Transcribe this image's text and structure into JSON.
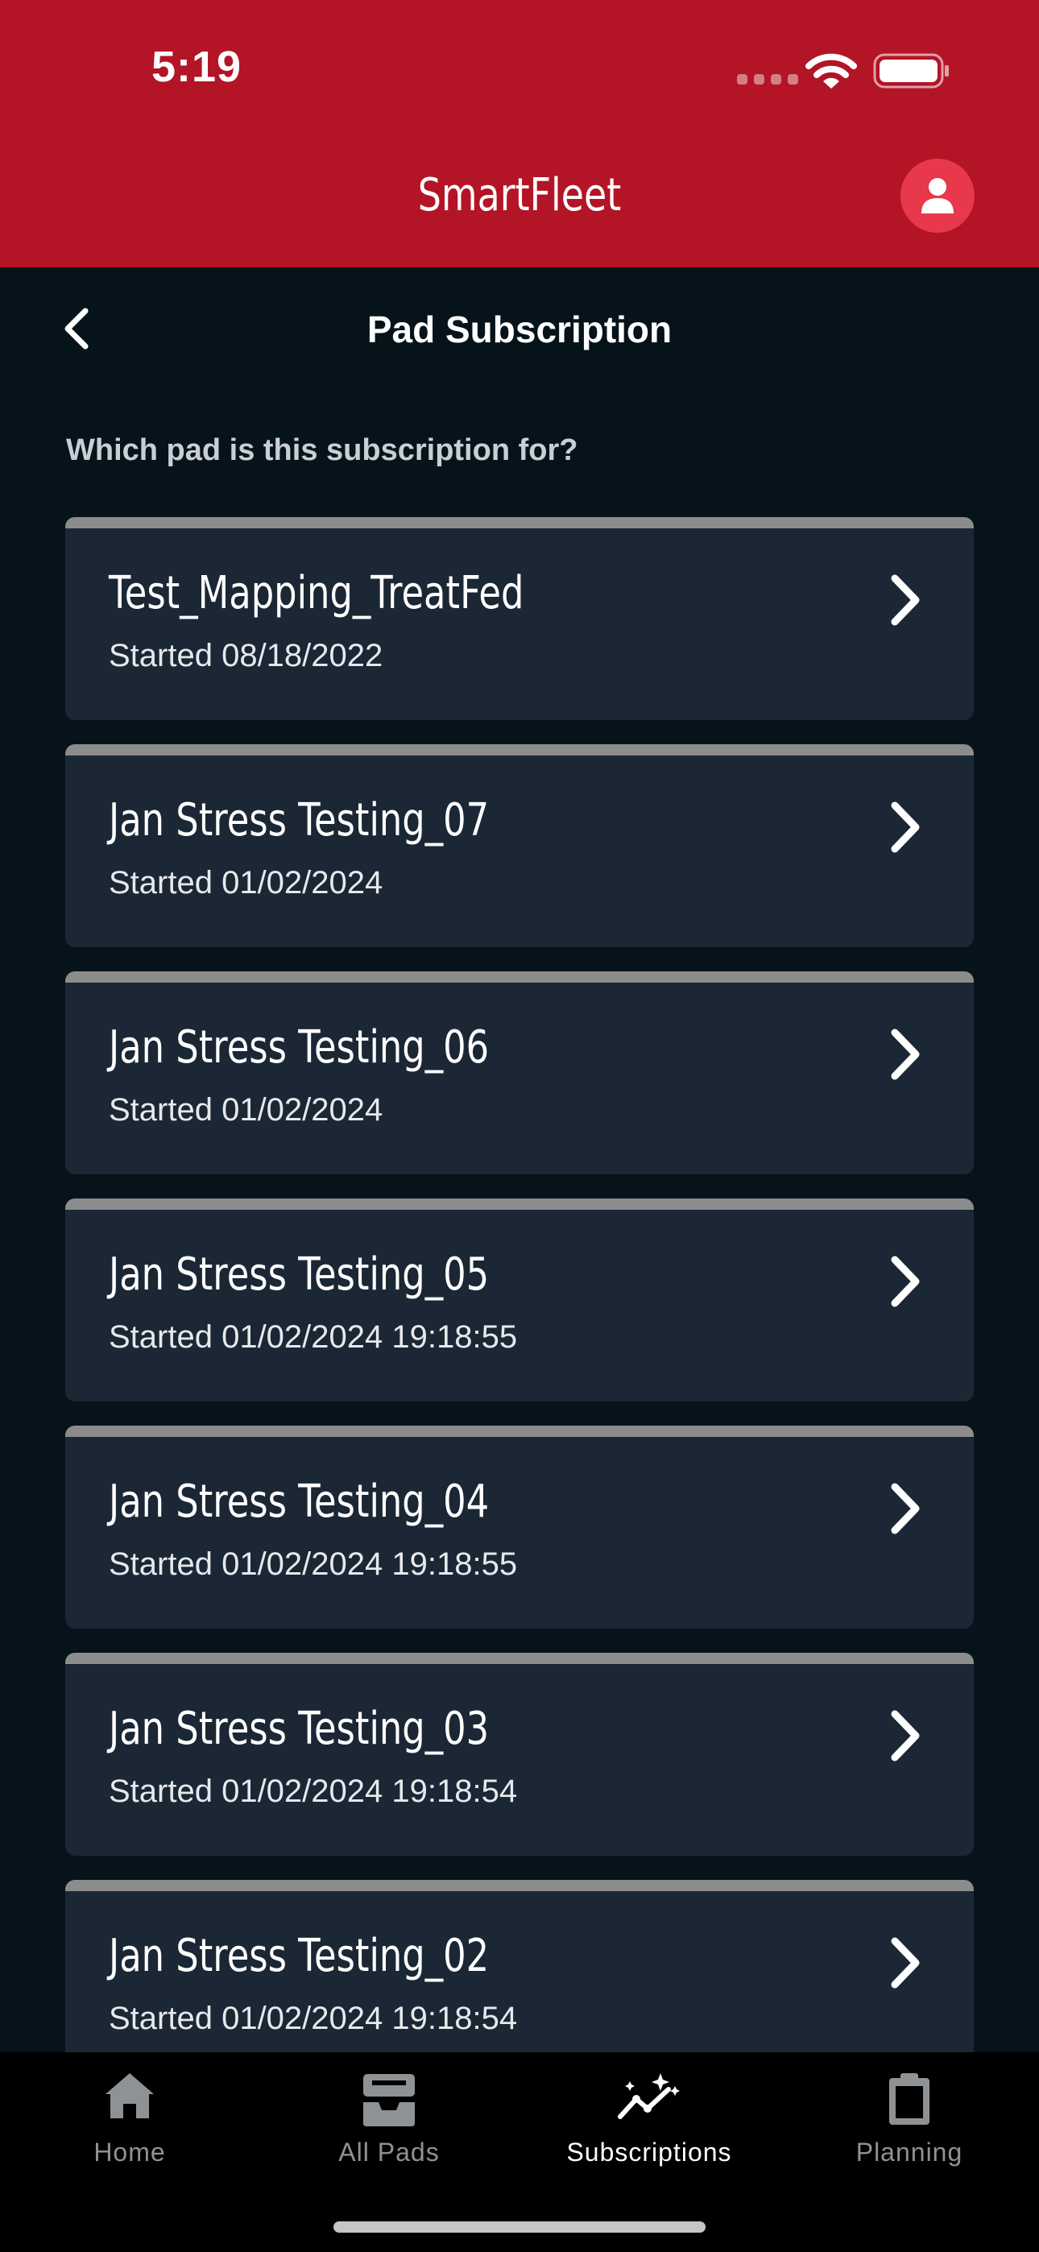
{
  "status_bar": {
    "time": "5:19"
  },
  "header": {
    "app_title": "SmartFleet"
  },
  "nav": {
    "title": "Pad Subscription"
  },
  "prompt": "Which pad is this subscription for?",
  "pads": [
    {
      "name": "Test_Mapping_TreatFed",
      "started": "Started 08/18/2022"
    },
    {
      "name": "Jan Stress Testing_07",
      "started": "Started 01/02/2024"
    },
    {
      "name": "Jan Stress Testing_06",
      "started": "Started 01/02/2024"
    },
    {
      "name": "Jan Stress Testing_05",
      "started": "Started 01/02/2024 19:18:55"
    },
    {
      "name": "Jan Stress Testing_04",
      "started": "Started 01/02/2024 19:18:55"
    },
    {
      "name": "Jan Stress Testing_03",
      "started": "Started 01/02/2024 19:18:54"
    },
    {
      "name": "Jan Stress Testing_02",
      "started": "Started 01/02/2024 19:18:54"
    }
  ],
  "tabs": [
    {
      "label": "Home",
      "icon": "home-icon",
      "active": false
    },
    {
      "label": "All Pads",
      "icon": "inbox-tray-icon",
      "active": false
    },
    {
      "label": "Subscriptions",
      "icon": "sparkle-chart-icon",
      "active": true
    },
    {
      "label": "Planning",
      "icon": "clipboard-icon",
      "active": false
    }
  ],
  "colors": {
    "header_red": "#b31426",
    "background": "#06131b",
    "card": "#1b2734",
    "card_top_border": "#8c8c8c",
    "avatar": "#e8384c",
    "tab_inactive": "#8f9295"
  }
}
